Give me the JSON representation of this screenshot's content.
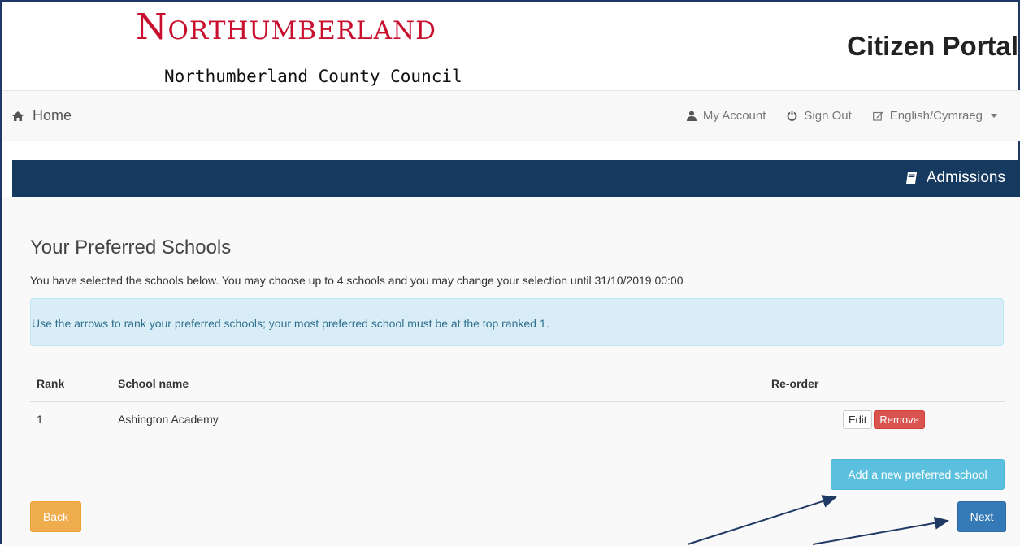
{
  "header": {
    "logo_text": "Northumberland",
    "subtitle": "Northumberland County Council",
    "portal_title": "Citizen Portal"
  },
  "nav": {
    "home": "Home",
    "my_account": "My Account",
    "sign_out": "Sign Out",
    "language": "English/Cymraeg"
  },
  "section": {
    "title": "Admissions"
  },
  "main": {
    "page_title": "Your Preferred Schools",
    "intro": "You have selected the schools below. You may choose up to 4 schools and you may change your selection until 31/10/2019 00:00",
    "alert": "Use the arrows to rank your preferred schools; your most preferred school must be at the top ranked 1.",
    "table": {
      "headers": [
        "Rank",
        "School name",
        "Re-order"
      ],
      "rows": [
        {
          "rank": "1",
          "school": "Ashington Academy",
          "edit_label": "Edit",
          "remove_label": "Remove"
        }
      ]
    },
    "add_button": "Add a new preferred school",
    "back_button": "Back",
    "next_button": "Next"
  },
  "colors": {
    "brand_red": "#c8102e",
    "section_bar": "#163a5f",
    "alert_bg": "#d9edf7",
    "btn_info": "#5bc0de",
    "btn_warning": "#f0ad4e",
    "btn_primary": "#337ab7",
    "btn_danger": "#d9534f"
  }
}
